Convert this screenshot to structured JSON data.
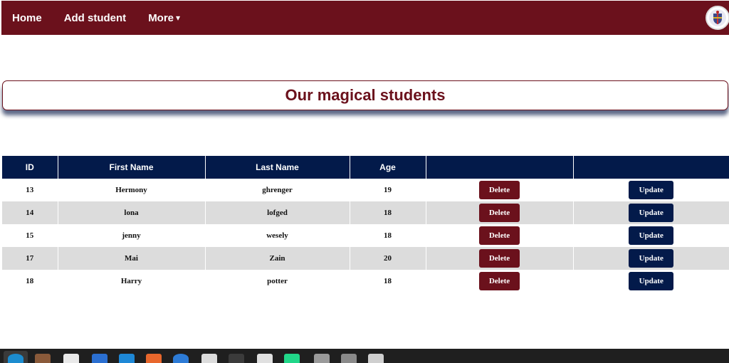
{
  "nav": {
    "home": "Home",
    "add_student": "Add student",
    "more": "More",
    "caret": "▾"
  },
  "header": {
    "title": "Our magical students"
  },
  "table": {
    "columns": [
      "ID",
      "First Name",
      "Last Name",
      "Age",
      "",
      ""
    ],
    "delete_label": "Delete",
    "update_label": "Update",
    "rows": [
      {
        "id": "13",
        "first": "Hermony",
        "last": "ghrenger",
        "age": "19"
      },
      {
        "id": "14",
        "first": "lona",
        "last": "lofged",
        "age": "18"
      },
      {
        "id": "15",
        "first": "jenny",
        "last": "wesely",
        "age": "18"
      },
      {
        "id": "17",
        "first": "Mai",
        "last": "Zain",
        "age": "20"
      },
      {
        "id": "18",
        "first": "Harry",
        "last": "potter",
        "age": "18"
      }
    ]
  },
  "colors": {
    "brand": "#6b111c",
    "navy": "#031a4a",
    "row_alt": "#dcdcdc"
  },
  "taskbar": {
    "icons": [
      "edge-icon",
      "files-icon",
      "firefox-icon",
      "writer-icon",
      "vscode-icon",
      "appstore-icon",
      "help-icon",
      "editor-icon",
      "terminal-icon",
      "doc-icon",
      "pycharm-icon",
      "app-icon",
      "app-icon",
      "app-icon"
    ]
  }
}
